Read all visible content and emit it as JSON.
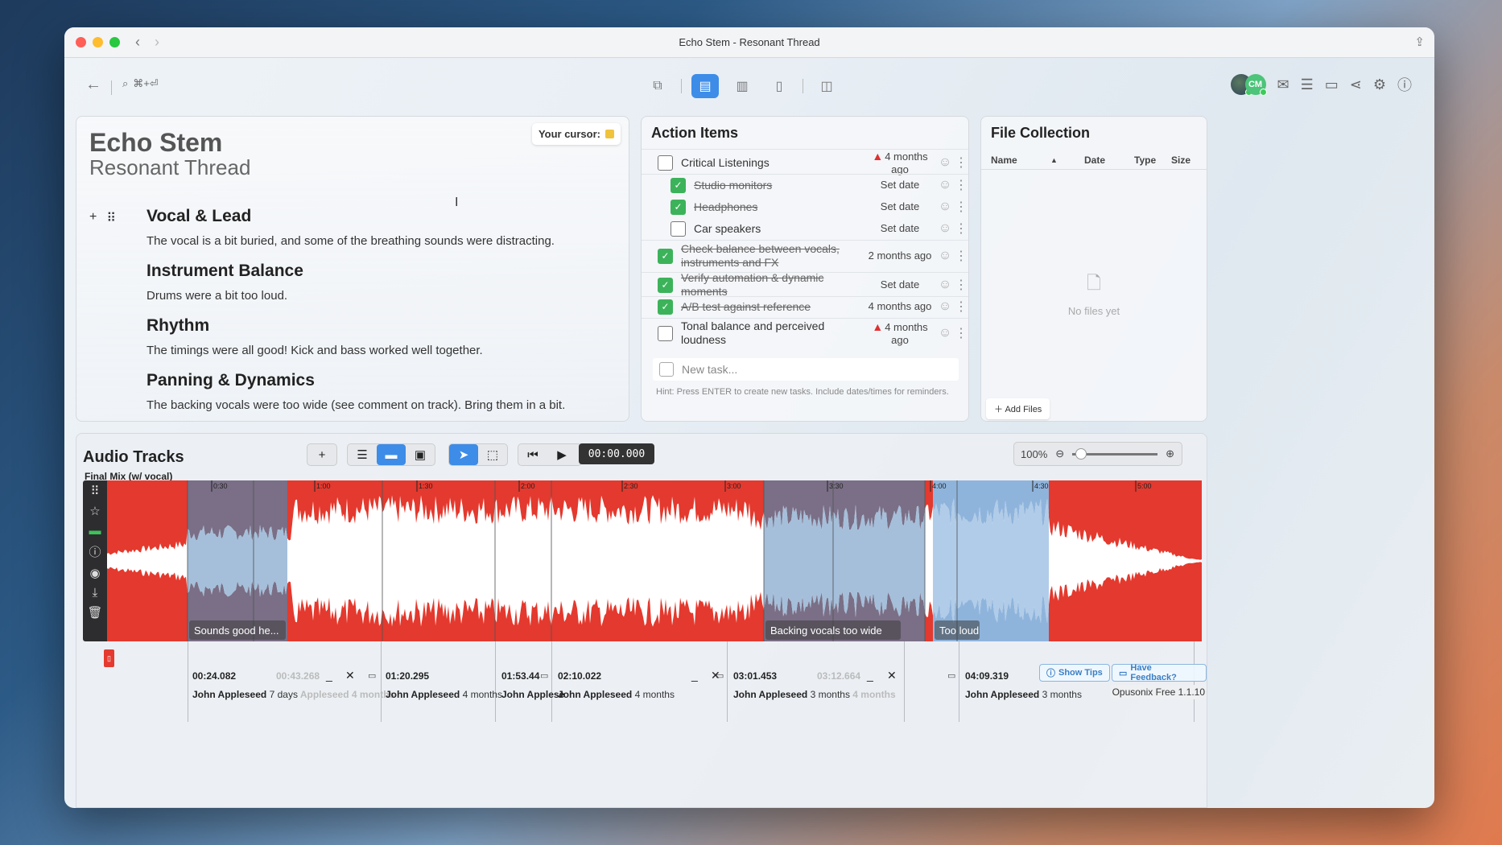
{
  "window": {
    "title": "Echo Stem - Resonant Thread"
  },
  "toolbar": {
    "search_shortcut": "⌘+⏎",
    "avatar_initials": "CM"
  },
  "notes": {
    "title": "Echo Stem",
    "subtitle": "Resonant Thread",
    "cursor_label": "Your cursor:",
    "cursor_color": "#f0c33c",
    "sections": [
      {
        "heading": "Vocal & Lead",
        "body": "The vocal is a bit buried, and some of the breathing sounds were distracting."
      },
      {
        "heading": "Instrument Balance",
        "body": "Drums were a bit too loud."
      },
      {
        "heading": "Rhythm",
        "body": "The timings were all good! Kick and bass worked well together."
      },
      {
        "heading": "Panning & Dynamics",
        "body": "The backing vocals were too wide (see comment on track). Bring them in a bit."
      }
    ]
  },
  "actions": {
    "title": "Action Items",
    "tasks": [
      {
        "label": "Critical Listenings",
        "date": "4 months ago",
        "checked": false,
        "warn": true,
        "indent": false
      },
      {
        "label": "Studio monitors",
        "date": "Set date",
        "checked": true,
        "warn": false,
        "indent": true
      },
      {
        "label": "Headphones",
        "date": "Set date",
        "checked": true,
        "warn": false,
        "indent": true
      },
      {
        "label": "Car speakers",
        "date": "Set date",
        "checked": false,
        "warn": false,
        "indent": true
      },
      {
        "label": "Check balance between vocals, instruments and FX",
        "date": "2 months ago",
        "checked": true,
        "warn": false,
        "indent": false
      },
      {
        "label": "Verify automation & dynamic moments",
        "date": "Set date",
        "checked": true,
        "warn": false,
        "indent": false
      },
      {
        "label": "A/B test against reference",
        "date": "4 months ago",
        "checked": true,
        "warn": false,
        "indent": false
      },
      {
        "label": "Tonal balance and perceived loudness",
        "date": "4 months ago",
        "checked": false,
        "warn": true,
        "indent": false
      }
    ],
    "new_task_placeholder": "New task...",
    "hint": "Hint: Press ENTER to create new tasks. Include dates/times for reminders."
  },
  "files": {
    "title": "File Collection",
    "columns": [
      "Name",
      "Date",
      "Type",
      "Size"
    ],
    "empty_text": "No files yet",
    "add_label": "Add Files"
  },
  "audio": {
    "title": "Audio Tracks",
    "timecode": "00:00.000",
    "zoom": "100%",
    "track_name": "Final Mix (w/ vocal)",
    "ruler": [
      "0:30",
      "1:00",
      "1:30",
      "2:00",
      "2:30",
      "3:00",
      "3:30",
      "4:00",
      "4:30",
      "5:00"
    ],
    "regions": [
      {
        "label": "Sounds good he..."
      },
      {
        "label": "Backing vocals too wide"
      },
      {
        "label": "Too loud"
      }
    ],
    "comments": [
      {
        "time": "00:24.082",
        "ghost_time": "00:43.268",
        "author": "John Appleseed",
        "ago": "7 days",
        "ghost": "Appleseed 4 months"
      },
      {
        "time": "01:20.295",
        "author": "John Appleseed",
        "ago": "4 months"
      },
      {
        "time": "01:53.44",
        "author": "John Applese",
        "ago": ""
      },
      {
        "time": "02:10.022",
        "author": "John Appleseed",
        "ago": "4 months"
      },
      {
        "time": "03:01.453",
        "ghost_time": "03:12.664",
        "author": "John Appleseed",
        "ago": "3 months",
        "ghost": "4 months"
      },
      {
        "time": "04:09.319",
        "author": "John Appleseed",
        "ago": "3 months"
      }
    ],
    "show_tips": "Show Tips",
    "feedback": "Have Feedback?",
    "version": "Opusonix Free 1.1.10"
  }
}
